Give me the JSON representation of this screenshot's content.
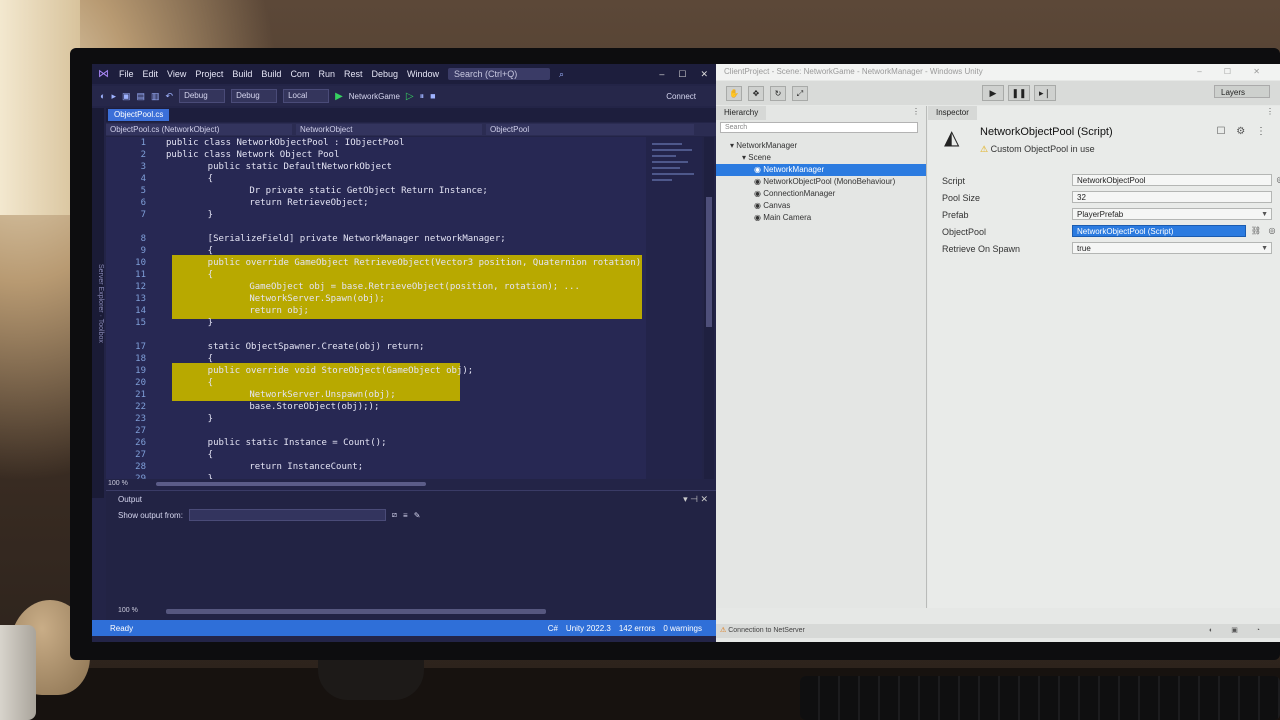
{
  "vs": {
    "menu": [
      "File",
      "Edit",
      "View",
      "Project",
      "Build",
      "Build",
      "Com",
      "Run",
      "Rest",
      "Debug",
      "Window"
    ],
    "search": "Search (Ctrl+Q)",
    "toolbar": {
      "debug": "Debug",
      "config": "Debug",
      "platform": "Local",
      "run": "NetworkGame",
      "right": "Connect"
    },
    "tab": "ObjectPool.cs",
    "nav": {
      "left": "ObjectPool.cs (NetworkObject)",
      "mid": "NetworkObject",
      "right": "ObjectPool"
    },
    "side_label": "Server Explorer · Toolbox",
    "code": [
      {
        "n": "1",
        "t": "public class NetworkObjectPool : IObjectPool"
      },
      {
        "n": "2",
        "t": "public class Network Object Pool"
      },
      {
        "n": "3",
        "t": "    public static DefaultNetworkObject"
      },
      {
        "n": "4",
        "t": "    {"
      },
      {
        "n": "5",
        "t": "        Dr private static GetObject Return Instance;"
      },
      {
        "n": "6",
        "t": "        return RetrieveObject;"
      },
      {
        "n": "7",
        "t": "    }"
      },
      {
        "n": "8",
        "t": "    [SerializeField] private NetworkManager networkManager;"
      },
      {
        "n": "9",
        "t": "    {"
      },
      {
        "n": "10",
        "t": "    public override GameObject RetrieveObject(Vector3 position, Quaternion rotation)"
      },
      {
        "n": "11",
        "t": "    {"
      },
      {
        "n": "12",
        "t": "        GameObject obj = base.RetrieveObject(position, rotation); ..."
      },
      {
        "n": "13",
        "t": "        NetworkServer.Spawn(obj);"
      },
      {
        "n": "14",
        "t": "        return obj;"
      },
      {
        "n": "15",
        "t": "    }"
      },
      {
        "n": "17",
        "t": "    static ObjectSpawner.Create(obj) return;"
      },
      {
        "n": "18",
        "t": "    {"
      },
      {
        "n": "19",
        "t": "    public override void StoreObject(GameObject obj);"
      },
      {
        "n": "20",
        "t": "    {"
      },
      {
        "n": "21",
        "t": "        NetworkServer.Unspawn(obj);"
      },
      {
        "n": "22",
        "t": "        base.StoreObject(obj););"
      },
      {
        "n": "23",
        "t": "    }"
      },
      {
        "n": "27",
        "t": ""
      },
      {
        "n": "26",
        "t": "    public static Instance = Count();"
      },
      {
        "n": "27",
        "t": "    {"
      },
      {
        "n": "28",
        "t": "        return InstanceCount;"
      },
      {
        "n": "29",
        "t": "    }"
      }
    ],
    "zoom": "100 %",
    "output_title": "Output",
    "output_from": "Show output from:",
    "status_ready": "Ready",
    "status_right": [
      "C#",
      "Unity 2022.3",
      "142 errors",
      "0 warnings"
    ]
  },
  "unity": {
    "title": "ClientProject - Scene: NetworkGame - NetworkManager - Windows Unity",
    "layout": "Layers",
    "hierarchy_tab": "Hierarchy",
    "search_placeholder": "Search",
    "hierarchy": [
      {
        "label": "NetworkManager",
        "depth": 0,
        "selected": false
      },
      {
        "label": "Scene",
        "depth": 1,
        "selected": false
      },
      {
        "label": "NetworkManager",
        "depth": 2,
        "selected": true
      },
      {
        "label": "NetworkObjectPool (MonoBehaviour)",
        "depth": 2,
        "selected": false
      },
      {
        "label": "ConnectionManager",
        "depth": 2,
        "selected": false
      },
      {
        "label": "Canvas",
        "depth": 2,
        "selected": false
      },
      {
        "label": "Main Camera",
        "depth": 2,
        "selected": false
      }
    ],
    "inspector_tab": "Inspector",
    "component_title": "NetworkObjectPool (Script)",
    "warning": "Custom ObjectPool in use",
    "props": [
      {
        "label": "Script",
        "value": "NetworkObjectPool"
      },
      {
        "label": "Pool Size",
        "value": "32"
      },
      {
        "label": "Prefab",
        "value": "PlayerPrefab"
      },
      {
        "label": "ObjectPool",
        "value": "NetworkObjectPool (Script)"
      },
      {
        "label": "Retrieve On Spawn",
        "value": "true"
      }
    ],
    "status": "Connection to NetServer"
  },
  "colors": {
    "vs_bg": "#272853",
    "highlight": "#b8a900",
    "vs_accent": "#2f6fd8",
    "unity_select": "#2b7be0"
  }
}
